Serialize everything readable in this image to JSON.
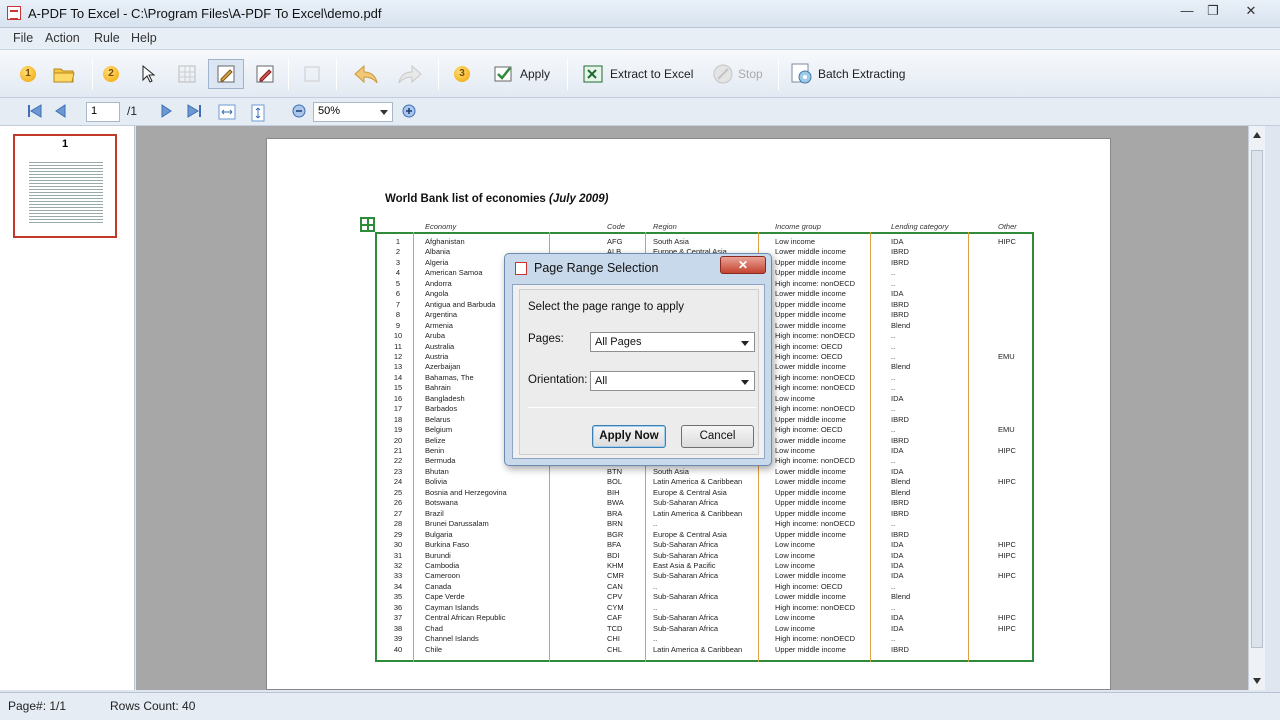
{
  "window": {
    "title": "A-PDF To Excel - C:\\Program Files\\A-PDF To Excel\\demo.pdf",
    "minimize": "—",
    "restore": "❐",
    "close": "✕"
  },
  "menu": [
    "File",
    "Action",
    "Rule",
    "Help"
  ],
  "toolbar": {
    "step1": "1",
    "step2": "2",
    "step3": "3",
    "apply_label": "Apply",
    "extract_label": "Extract to Excel",
    "stop_label": "Stop",
    "batch_label": "Batch Extracting"
  },
  "nav": {
    "page_value": "1",
    "page_total": "/1",
    "zoom": "50%"
  },
  "thumbnail": {
    "page_number": "1"
  },
  "document": {
    "title": "World Bank list of economies",
    "title_date": "(July 2009)",
    "headers": [
      "Economy",
      "Code",
      "Region",
      "Income group",
      "Lending category",
      "Other"
    ],
    "rows": [
      [
        "1",
        "Afghanistan",
        "AFG",
        "South Asia",
        "Low income",
        "IDA",
        "HIPC"
      ],
      [
        "2",
        "Albania",
        "ALB",
        "Europe & Central Asia",
        "Lower middle income",
        "IBRD",
        ""
      ],
      [
        "3",
        "Algeria",
        "",
        "",
        "Upper middle income",
        "IBRD",
        ""
      ],
      [
        "4",
        "American Samoa",
        "",
        "",
        "Upper middle income",
        "..",
        ""
      ],
      [
        "5",
        "Andorra",
        "",
        "",
        "High income: nonOECD",
        "..",
        ""
      ],
      [
        "6",
        "Angola",
        "",
        "",
        "Lower middle income",
        "IDA",
        ""
      ],
      [
        "7",
        "Antigua and Barbuda",
        "",
        "",
        "Upper middle income",
        "IBRD",
        ""
      ],
      [
        "8",
        "Argentina",
        "",
        "",
        "Upper middle income",
        "IBRD",
        ""
      ],
      [
        "9",
        "Armenia",
        "",
        "",
        "Lower middle income",
        "Blend",
        ""
      ],
      [
        "10",
        "Aruba",
        "",
        "",
        "High income: nonOECD",
        "..",
        ""
      ],
      [
        "11",
        "Australia",
        "",
        "",
        "High income: OECD",
        "..",
        ""
      ],
      [
        "12",
        "Austria",
        "",
        "",
        "High income: OECD",
        "..",
        "EMU"
      ],
      [
        "13",
        "Azerbaijan",
        "",
        "",
        "Lower middle income",
        "Blend",
        ""
      ],
      [
        "14",
        "Bahamas, The",
        "",
        "",
        "High income: nonOECD",
        "..",
        ""
      ],
      [
        "15",
        "Bahrain",
        "",
        "",
        "High income: nonOECD",
        "..",
        ""
      ],
      [
        "16",
        "Bangladesh",
        "",
        "",
        "Low income",
        "IDA",
        ""
      ],
      [
        "17",
        "Barbados",
        "",
        "",
        "High income: nonOECD",
        "..",
        ""
      ],
      [
        "18",
        "Belarus",
        "",
        "",
        "Upper middle income",
        "IBRD",
        ""
      ],
      [
        "19",
        "Belgium",
        "",
        "",
        "High income: OECD",
        "..",
        "EMU"
      ],
      [
        "20",
        "Belize",
        "",
        "",
        "Lower middle income",
        "IBRD",
        ""
      ],
      [
        "21",
        "Benin",
        "",
        "",
        "Low income",
        "IDA",
        "HIPC"
      ],
      [
        "22",
        "Bermuda",
        "",
        "",
        "High income: nonOECD",
        "..",
        ""
      ],
      [
        "23",
        "Bhutan",
        "BTN",
        "South Asia",
        "Lower middle income",
        "IDA",
        ""
      ],
      [
        "24",
        "Bolivia",
        "BOL",
        "Latin America & Caribbean",
        "Lower middle income",
        "Blend",
        "HIPC"
      ],
      [
        "25",
        "Bosnia and Herzegovina",
        "BIH",
        "Europe & Central Asia",
        "Upper middle income",
        "Blend",
        ""
      ],
      [
        "26",
        "Botswana",
        "BWA",
        "Sub-Saharan Africa",
        "Upper middle income",
        "IBRD",
        ""
      ],
      [
        "27",
        "Brazil",
        "BRA",
        "Latin America & Caribbean",
        "Upper middle income",
        "IBRD",
        ""
      ],
      [
        "28",
        "Brunei Darussalam",
        "BRN",
        "..",
        "High income: nonOECD",
        "..",
        ""
      ],
      [
        "29",
        "Bulgaria",
        "BGR",
        "Europe & Central Asia",
        "Upper middle income",
        "IBRD",
        ""
      ],
      [
        "30",
        "Burkina Faso",
        "BFA",
        "Sub-Saharan Africa",
        "Low income",
        "IDA",
        "HIPC"
      ],
      [
        "31",
        "Burundi",
        "BDI",
        "Sub-Saharan Africa",
        "Low income",
        "IDA",
        "HIPC"
      ],
      [
        "32",
        "Cambodia",
        "KHM",
        "East Asia & Pacific",
        "Low income",
        "IDA",
        ""
      ],
      [
        "33",
        "Cameroon",
        "CMR",
        "Sub-Saharan Africa",
        "Lower middle income",
        "IDA",
        "HIPC"
      ],
      [
        "34",
        "Canada",
        "CAN",
        "..",
        "High income: OECD",
        "..",
        ""
      ],
      [
        "35",
        "Cape Verde",
        "CPV",
        "Sub-Saharan Africa",
        "Lower middle income",
        "Blend",
        ""
      ],
      [
        "36",
        "Cayman Islands",
        "CYM",
        "..",
        "High income: nonOECD",
        "..",
        ""
      ],
      [
        "37",
        "Central African Republic",
        "CAF",
        "Sub-Saharan Africa",
        "Low income",
        "IDA",
        "HIPC"
      ],
      [
        "38",
        "Chad",
        "TCD",
        "Sub-Saharan Africa",
        "Low income",
        "IDA",
        "HIPC"
      ],
      [
        "39",
        "Channel Islands",
        "CHI",
        "..",
        "High income: nonOECD",
        "..",
        ""
      ],
      [
        "40",
        "Chile",
        "CHL",
        "Latin America & Caribbean",
        "Upper middle income",
        "IBRD",
        ""
      ]
    ]
  },
  "dialog": {
    "title": "Page Range Selection",
    "close": "✕",
    "instruction": "Select the page range to apply",
    "pages_label": "Pages:",
    "pages_value": "All Pages",
    "orientation_label": "Orientation:",
    "orientation_value": "All",
    "apply_button": "Apply Now",
    "cancel_button": "Cancel"
  },
  "status": {
    "page": "Page#: 1/1",
    "rows": "Rows Count: 40"
  },
  "colors": {
    "table_border": "#2e8b3a",
    "column_rule": "#e0a040",
    "thumb_border": "#c0392b"
  }
}
